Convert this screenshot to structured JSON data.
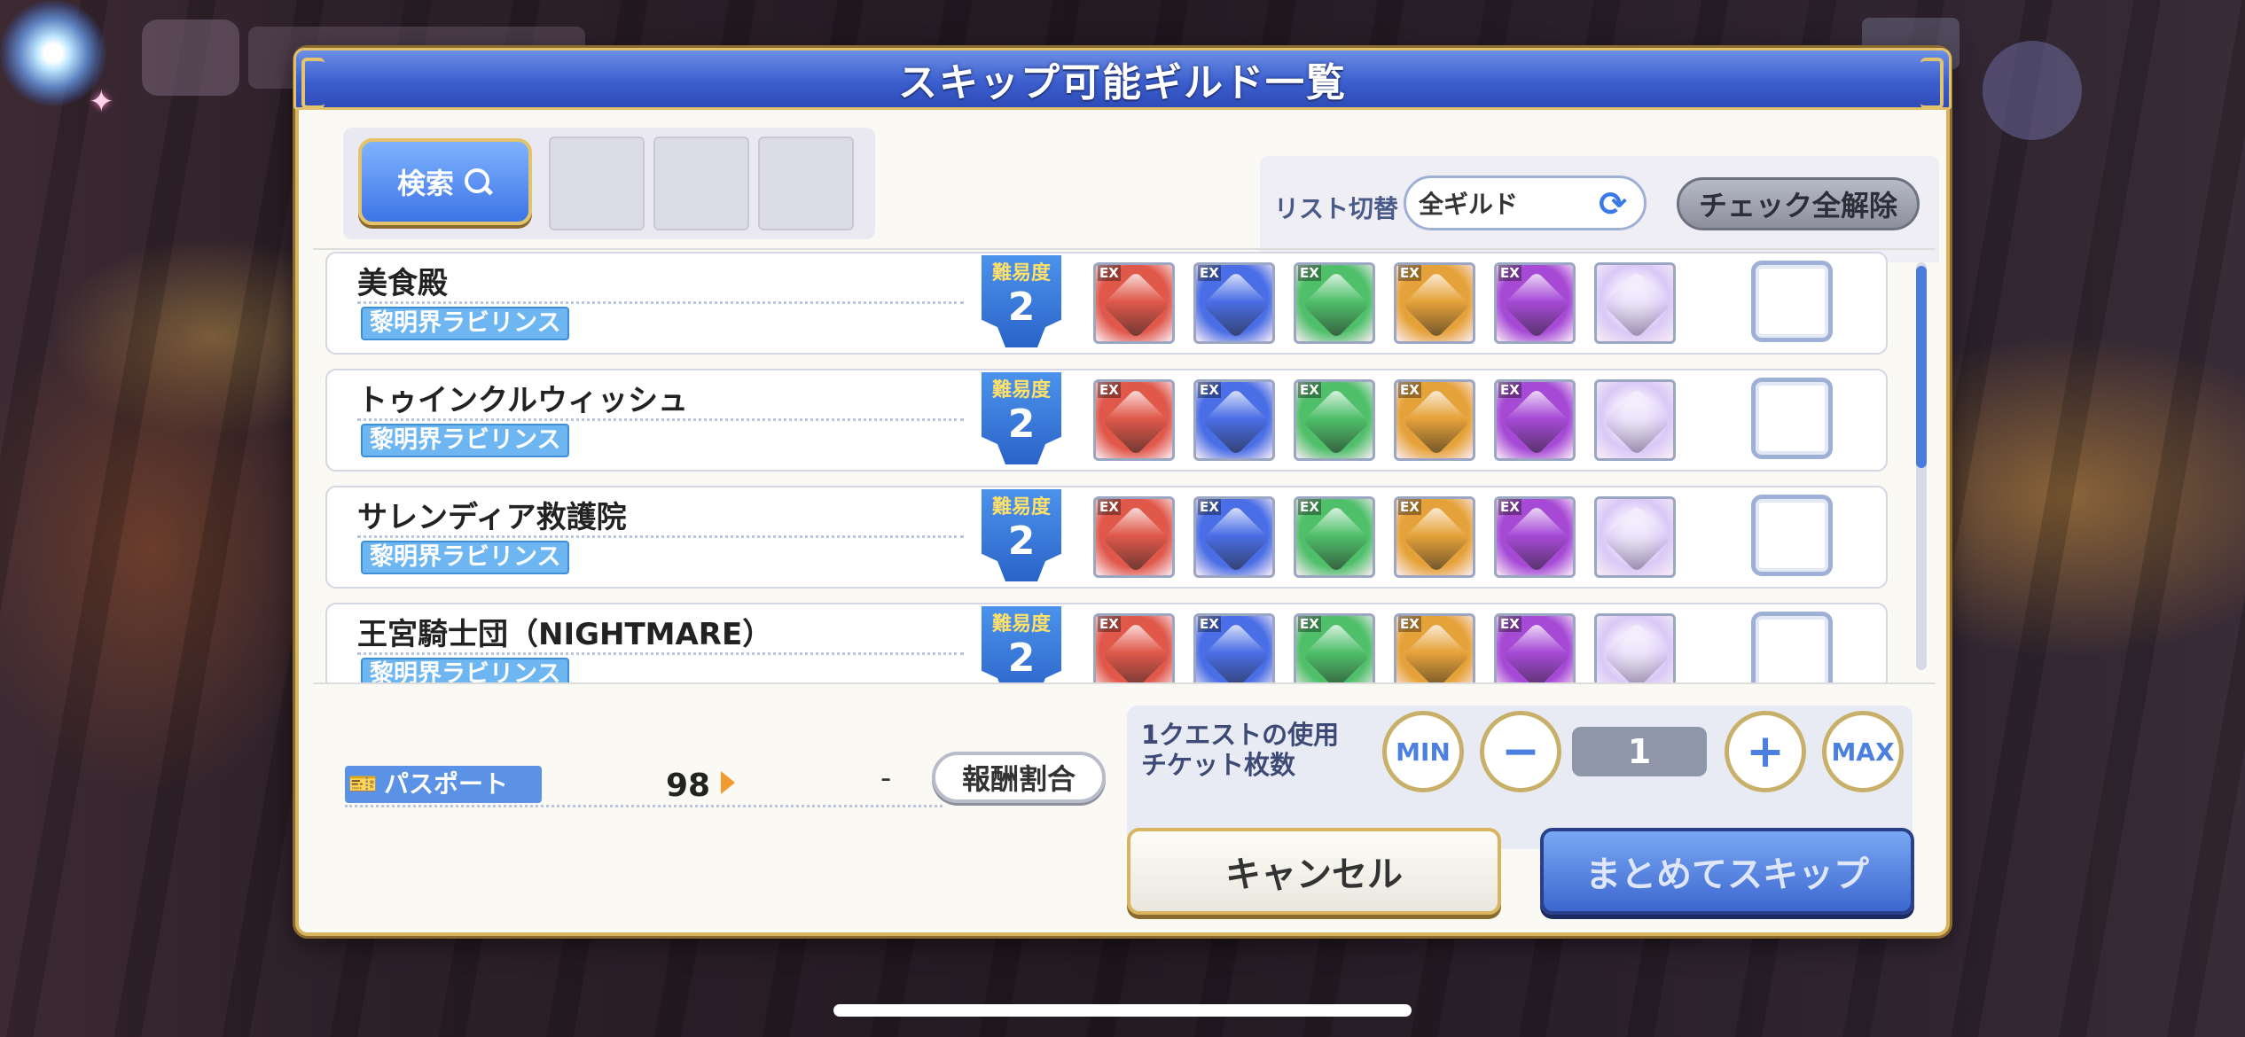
{
  "dialog": {
    "title": "スキップ可能ギルド一覧",
    "search_label": "検索",
    "list_switch_label": "リスト切替",
    "list_switch_value": "全ギルド",
    "uncheck_all_label": "チェック全解除"
  },
  "guilds": [
    {
      "name": "美食殿",
      "area": "黎明界ラビリンス",
      "difficulty_label": "難易度",
      "difficulty": "2",
      "checked": false
    },
    {
      "name": "トゥインクルウィッシュ",
      "area": "黎明界ラビリンス",
      "difficulty_label": "難易度",
      "difficulty": "2",
      "checked": false
    },
    {
      "name": "サレンディア救護院",
      "area": "黎明界ラビリンス",
      "difficulty_label": "難易度",
      "difficulty": "2",
      "checked": false
    },
    {
      "name": "王宮騎士団（NIGHTMARE）",
      "area": "黎明界ラビリンス",
      "difficulty_label": "難易度",
      "difficulty": "2",
      "checked": false
    }
  ],
  "reward_icons": {
    "ex_label": "EX",
    "colors": [
      "#e0584a",
      "#4a6ee6",
      "#4fbf6a",
      "#e6a23a",
      "#a64ad6",
      "#d9c8f7"
    ]
  },
  "passport": {
    "label": "パスポート",
    "value": "98",
    "result": "-"
  },
  "reward_ratio_label": "報酬割合",
  "ticket": {
    "label_line1": "1クエストの使用",
    "label_line2": "チケット枚数",
    "min_label": "MIN",
    "minus_label": "−",
    "quantity": "1",
    "plus_label": "+",
    "max_label": "MAX"
  },
  "buttons": {
    "cancel": "キャンセル",
    "skip_all": "まとめてスキップ"
  },
  "colors": {
    "title_bar": "#3c5fcf",
    "gold_border": "#d9b45e",
    "accent_blue": "#4c7be0"
  }
}
